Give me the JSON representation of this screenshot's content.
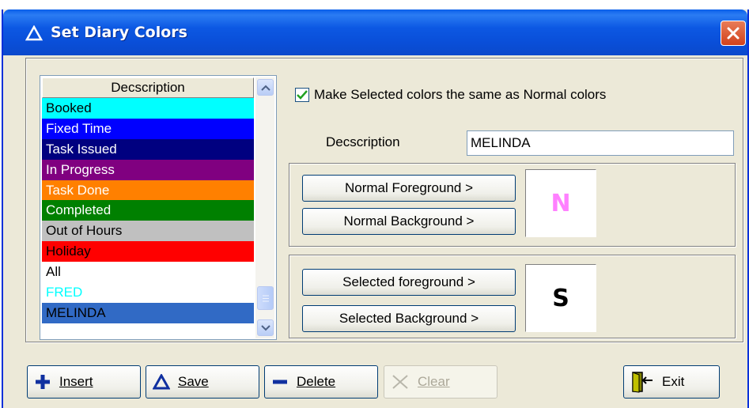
{
  "window": {
    "title": "Set Diary Colors"
  },
  "list": {
    "header": "Decscription",
    "items": [
      {
        "label": "Booked",
        "bg": "#00ffff",
        "fg": "#000000"
      },
      {
        "label": "Fixed Time",
        "bg": "#0000ff",
        "fg": "#ffffff"
      },
      {
        "label": "Task Issued",
        "bg": "#000080",
        "fg": "#ffffff"
      },
      {
        "label": "In Progress",
        "bg": "#800080",
        "fg": "#ffffff"
      },
      {
        "label": "Task Done",
        "bg": "#ff8000",
        "fg": "#ffffff"
      },
      {
        "label": "Completed",
        "bg": "#008000",
        "fg": "#ffffff"
      },
      {
        "label": "Out of Hours",
        "bg": "#c0c0c0",
        "fg": "#000000"
      },
      {
        "label": "Holiday",
        "bg": "#ff0000",
        "fg": "#000000"
      },
      {
        "label": "All",
        "bg": "#ffffff",
        "fg": "#000000"
      },
      {
        "label": "FRED",
        "bg": "#ffffff",
        "fg": "#00ffff"
      },
      {
        "label": "MELINDA",
        "bg": "#316ac5",
        "fg": "#000000"
      }
    ]
  },
  "options": {
    "same_colors_label": "Make Selected colors the same as Normal colors",
    "same_colors_checked": true
  },
  "description": {
    "label": "Decscription",
    "value": "MELINDA"
  },
  "normal": {
    "foreground_label": "Normal Foreground >",
    "background_label": "Normal Background >",
    "preview_char": "N",
    "preview_color": "#ff80ff"
  },
  "selected": {
    "foreground_label": "Selected foreground >",
    "background_label": "Selected Background >",
    "preview_char": "S",
    "preview_color": "#000000"
  },
  "toolbar": {
    "insert_label": "Insert",
    "save_label": "Save",
    "delete_label": "Delete",
    "clear_label": "Clear",
    "exit_label": "Exit"
  }
}
